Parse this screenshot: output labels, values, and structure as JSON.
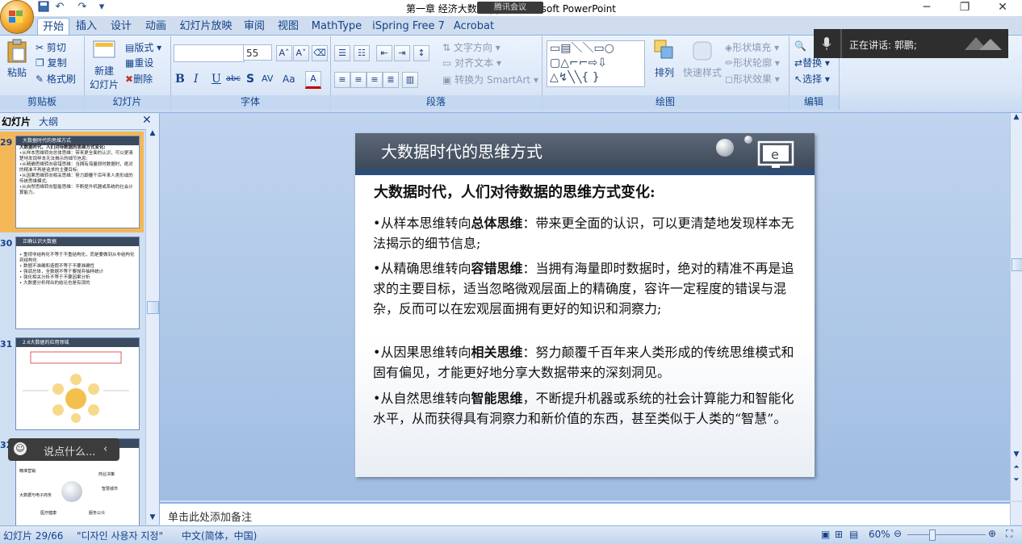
{
  "window": {
    "title": "第一章 经济大数据.ppt - Microsoft PowerPoint",
    "meeting_chip": "腾讯会议"
  },
  "tabs": [
    {
      "label": "开始",
      "active": true
    },
    {
      "label": "插入"
    },
    {
      "label": "设计"
    },
    {
      "label": "动画"
    },
    {
      "label": "幻灯片放映"
    },
    {
      "label": "审阅"
    },
    {
      "label": "视图"
    },
    {
      "label": "MathType"
    },
    {
      "label": "iSpring Free 7"
    },
    {
      "label": "Acrobat"
    }
  ],
  "ribbon": {
    "clipboard": {
      "paste": "粘贴",
      "cut": "剪切",
      "copy": "复制",
      "format_painter": "格式刷",
      "label": "剪贴板"
    },
    "slides": {
      "new_slide": "新建",
      "new_slide2": "幻灯片",
      "layout": "版式",
      "reset": "重设",
      "delete": "删除",
      "label": "幻灯片"
    },
    "font": {
      "font_name": "",
      "font_size": "55",
      "label": "字体",
      "bold": "B",
      "italic": "I",
      "underline": "U",
      "strike": "abc",
      "shadow": "S",
      "spacing": "AV",
      "case": "Aa"
    },
    "paragraph": {
      "text_direction": "文字方向",
      "align_text": "对齐文本",
      "smartart": "转换为 SmartArt",
      "label": "段落"
    },
    "drawing": {
      "arrange": "排列",
      "quick_styles": "快速样式",
      "shape_fill": "形状填充",
      "shape_outline": "形状轮廓",
      "shape_effects": "形状效果",
      "label": "绘图"
    },
    "editing": {
      "replace": "替换",
      "select": "选择",
      "label": "编辑"
    }
  },
  "speaking": {
    "text": "正在讲话: 郭鹏;"
  },
  "panel": {
    "tab_slides": "幻灯片",
    "tab_outline": "大纲",
    "thumbs": [
      {
        "num": "29",
        "title": "大数据时代的思维方式",
        "lines": [
          "大数据时代，人们对待数据的思维方式变化:",
          "•从样本思维转向总体思维：带来更全面的认识，可以更清楚地发现样本无法揭示的细节信息;",
          "•从精确思维转向容错思维：当拥有海量即时数据时，绝对的精准不再是追求的主要目标;",
          "•从因果思维转向相关思维：努力颠覆千百年来人类形成的传统思维模式;",
          "•从自然思维转向智能思维：不断提升机器或系统的社会计算能力。"
        ]
      },
      {
        "num": "30",
        "title": "正确认识大数据",
        "lines": [
          "• 重视非结构化不等于不重结构化，而是要做到从非结构化到结构化",
          "• 数据不准确和造假不等于不要准确性",
          "• 强调总体，全数据不等于要抛弃抽样统计",
          "• 强化相关分析不等于不要因果分析",
          "• 大数据分析得出的结论也是有误的"
        ]
      },
      {
        "num": "31",
        "title": "2.6大数据的应用领域",
        "lines": []
      },
      {
        "num": "32",
        "title": "大数据应用领域",
        "lines": [
          "服务公众",
          "精准营销",
          "商业决策",
          "智慧城市",
          "医疗健康",
          "大数据与电子商务"
        ]
      }
    ],
    "saying": "说点什么..."
  },
  "slide": {
    "title": "大数据时代的思维方式",
    "heading": "大数据时代，人们对待数据的思维方式变化:",
    "bullets": [
      {
        "prefix": "•从样本思维转向",
        "bold": "总体思维",
        "rest": "：带来更全面的认识，可以更清楚地发现样本无法揭示的细节信息;"
      },
      {
        "prefix": "•从精确思维转向",
        "bold": "容错思维",
        "rest": "：当拥有海量即时数据时，绝对的精准不再是追求的主要目标，适当忽略微观层面上的精确度，容许一定程度的错误与混杂，反而可以在宏观层面拥有更好的知识和洞察力;"
      },
      {
        "prefix": "•从因果思维转向",
        "bold": "相关思维",
        "rest": "：努力颠覆千百年来人类形成的传统思维模式和固有偏见，才能更好地分享大数据带来的深刻洞见。"
      },
      {
        "prefix": "•从自然思维转向",
        "bold": "智能思维",
        "rest": "，不断提升机器或系统的社会计算能力和智能化水平，从而获得具有洞察力和新价值的东西，甚至类似于人类的“智慧”。"
      }
    ]
  },
  "notes": {
    "placeholder": "单击此处添加备注"
  },
  "status": {
    "slide_count": "幻灯片 29/66",
    "theme": "\"디자인 사용자 지정\"",
    "language": "中文(简体，中国)",
    "zoom": "60%"
  }
}
